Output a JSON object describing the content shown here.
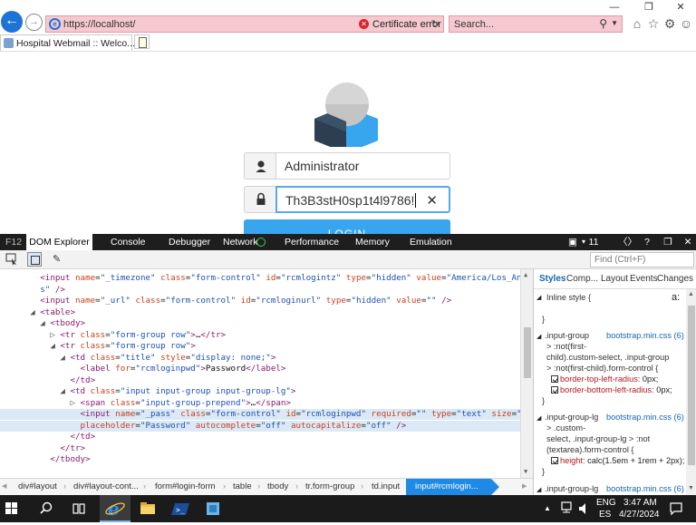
{
  "browser": {
    "url": "https://localhost/",
    "cert_error": "Certificate error",
    "search_placeholder": "Search...",
    "tab_title": "Hospital Webmail :: Welco...",
    "icons": [
      "back-icon",
      "forward-icon",
      "home-icon",
      "favorites-icon",
      "settings-icon",
      "smiley-icon"
    ]
  },
  "webpage": {
    "username": "Administrator",
    "password_text": "Th3B3stH0sp1t4l9786!",
    "login_label": "LOGIN",
    "accent": "#37a6ef"
  },
  "devtools": {
    "f12": "F12",
    "tabs": [
      "DOM Explorer",
      "Console",
      "Debugger",
      "Network",
      "Performance",
      "Memory",
      "Emulation"
    ],
    "emulation_count": "11",
    "find_placeholder": "Find (Ctrl+F)",
    "style_tabs": [
      "Styles",
      "Comp...",
      "Layout",
      "Events",
      "Changes"
    ],
    "breadcrumbs": [
      "div#layout",
      "div#layout-cont...",
      "form#login-form",
      "table",
      "tbody",
      "tr.form-group",
      "td.input",
      "input#rcmlogin..."
    ],
    "styles": {
      "inline": "Inline style  {",
      "close": "}",
      "rule1_sel": [
        ".input-group",
        "> :not(first-",
        "child).custom-select, .input-group",
        "> :not(first-child).form-control  {"
      ],
      "rule1_src": "bootstrap.min.css (6)",
      "rule1_props": [
        [
          "border-top-left-radius:",
          "0px;"
        ],
        [
          "border-bottom-left-radius:",
          "0px;"
        ]
      ],
      "rule2_sel": [
        ".input-group-lg",
        "> .custom-",
        "select, .input-group-lg > :not",
        "(textarea).form-control  {"
      ],
      "rule2_src": "bootstrap.min.css (6)",
      "rule2_props": [
        [
          "height:",
          "calc(1.5em + 1rem + 2px);"
        ]
      ],
      "rule3_sel": ".input-group-lg",
      "rule3_src": "bootstrap.min.css (6)",
      "aa": "a:"
    }
  },
  "taskbar": {
    "lang1": "ENG",
    "lang2": "ES",
    "time": "3:47 AM",
    "date": "4/27/2024"
  }
}
